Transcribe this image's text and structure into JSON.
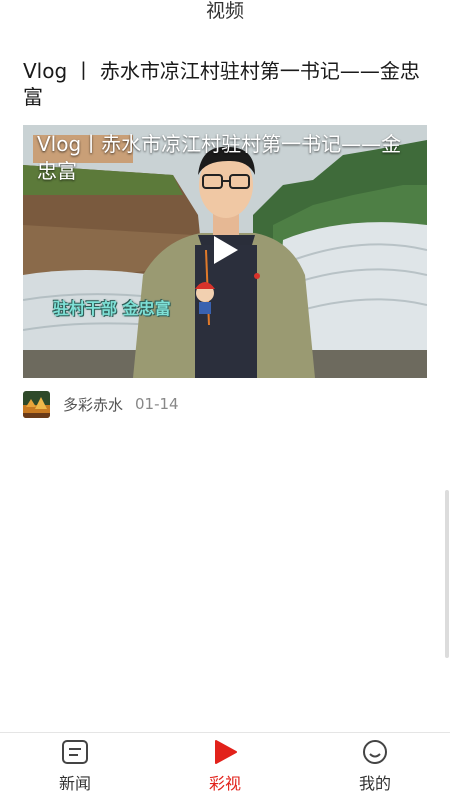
{
  "header": {
    "title": "视频"
  },
  "article": {
    "title": "Vlog  丨  赤水市凉江村驻村第一书记——金忠富",
    "source": "多彩赤水",
    "date": "01-14"
  },
  "video": {
    "overlay_title": "Vlog丨赤水市凉江村驻村第一书记——金忠富",
    "caption": "驻村干部 金忠富",
    "play_icon": "play-icon"
  },
  "bottom_nav": {
    "items": [
      {
        "label": "新闻",
        "icon": "news-icon",
        "active": false
      },
      {
        "label": "彩视",
        "icon": "play-icon",
        "active": true
      },
      {
        "label": "我的",
        "icon": "smiley-icon",
        "active": false
      }
    ],
    "active_color": "#e2221b",
    "inactive_color": "#333333"
  }
}
